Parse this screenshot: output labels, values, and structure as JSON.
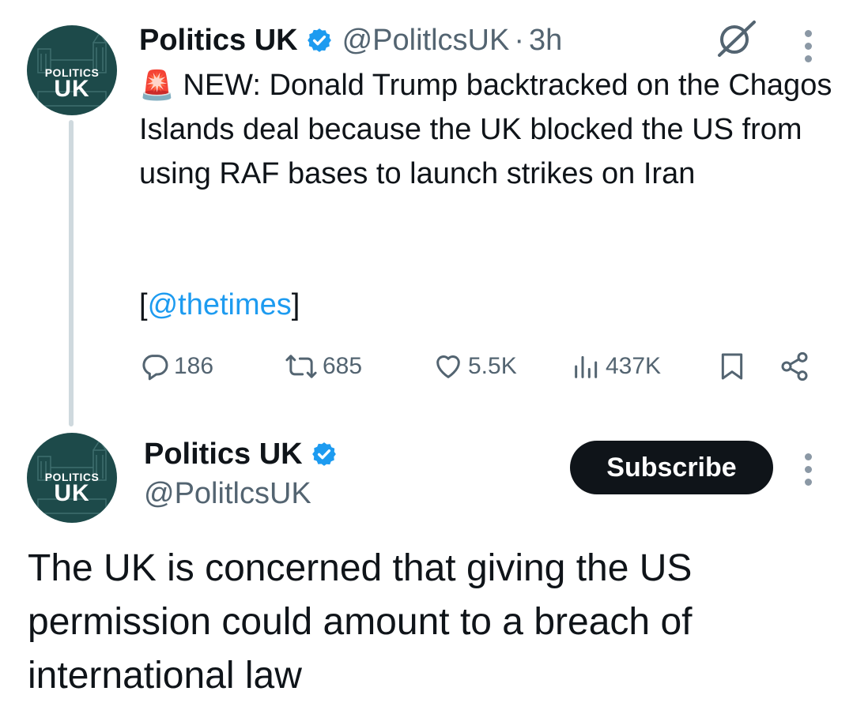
{
  "tweet1": {
    "avatar_top": "POLITICS",
    "avatar_big": "UK",
    "name": "Politics UK",
    "handle": "@PolitlcsUK",
    "separator": "·",
    "time": "3h",
    "emoji": "🚨",
    "text": "NEW: Donald Trump backtracked on the Chagos Islands deal because the UK blocked the US from using RAF bases to launch strikes on Iran",
    "bracket_open": "[",
    "link": "@thetimes",
    "bracket_close": "]",
    "actions": {
      "replies": "186",
      "reposts": "685",
      "likes": "5.5K",
      "views": "437K"
    },
    "icons": [
      "grok-icon",
      "more-icon",
      "reply-icon",
      "repost-icon",
      "like-icon",
      "views-icon",
      "bookmark-icon",
      "share-icon",
      "verified-badge-icon"
    ]
  },
  "tweet2": {
    "avatar_top": "POLITICS",
    "avatar_big": "UK",
    "name": "Politics UK",
    "handle": "@PolitlcsUK",
    "subscribe_label": "Subscribe",
    "text": "The UK is concerned that giving the US permission could amount to a  breach of international law"
  },
  "colors": {
    "verified": "#1d9bf0",
    "link": "#1d9bf0",
    "secondary_text": "#536471",
    "avatar_bg": "#1d4a4a",
    "button_bg": "#0f1419"
  }
}
